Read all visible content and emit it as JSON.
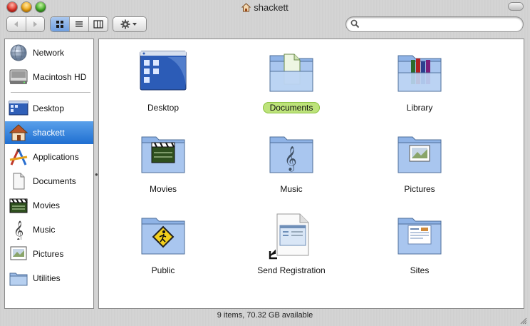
{
  "window": {
    "title": "shackett",
    "status": "9 items, 70.32 GB available"
  },
  "toolbar": {
    "back_icon": "left-arrow-icon",
    "forward_icon": "right-arrow-icon",
    "views": [
      "icon-view-icon",
      "list-view-icon",
      "column-view-icon"
    ],
    "active_view": 0,
    "action_icon": "gear-icon",
    "search": {
      "value": "",
      "placeholder": ""
    }
  },
  "sidebar": {
    "items": [
      {
        "label": "Network",
        "icon": "network-globe-icon",
        "selected": false
      },
      {
        "label": "Macintosh HD",
        "icon": "hard-drive-icon",
        "selected": false
      },
      {
        "label": "Desktop",
        "icon": "desktop-icon",
        "selected": false
      },
      {
        "label": "shackett",
        "icon": "home-icon",
        "selected": true
      },
      {
        "label": "Applications",
        "icon": "applications-icon",
        "selected": false
      },
      {
        "label": "Documents",
        "icon": "document-icon",
        "selected": false
      },
      {
        "label": "Movies",
        "icon": "clapperboard-icon",
        "selected": false
      },
      {
        "label": "Music",
        "icon": "treble-clef-icon",
        "selected": false
      },
      {
        "label": "Pictures",
        "icon": "picture-icon",
        "selected": false
      },
      {
        "label": "Utilities",
        "icon": "folder-icon",
        "selected": false
      }
    ]
  },
  "main": {
    "items": [
      {
        "label": "Desktop",
        "icon": "desktop-folder-icon",
        "highlighted": false
      },
      {
        "label": "Documents",
        "icon": "documents-folder-icon",
        "highlighted": true
      },
      {
        "label": "Library",
        "icon": "library-folder-icon",
        "highlighted": false
      },
      {
        "label": "Movies",
        "icon": "movies-folder-icon",
        "highlighted": false
      },
      {
        "label": "Music",
        "icon": "music-folder-icon",
        "highlighted": false
      },
      {
        "label": "Pictures",
        "icon": "pictures-folder-icon",
        "highlighted": false
      },
      {
        "label": "Public",
        "icon": "public-folder-icon",
        "highlighted": false
      },
      {
        "label": "Send Registration",
        "icon": "registration-alias-icon",
        "highlighted": false
      },
      {
        "label": "Sites",
        "icon": "sites-folder-icon",
        "highlighted": false
      }
    ]
  },
  "colors": {
    "selection": "#1f6fd1",
    "label_highlight": "#bde37a",
    "folder_blue": "#8fb3e6"
  }
}
